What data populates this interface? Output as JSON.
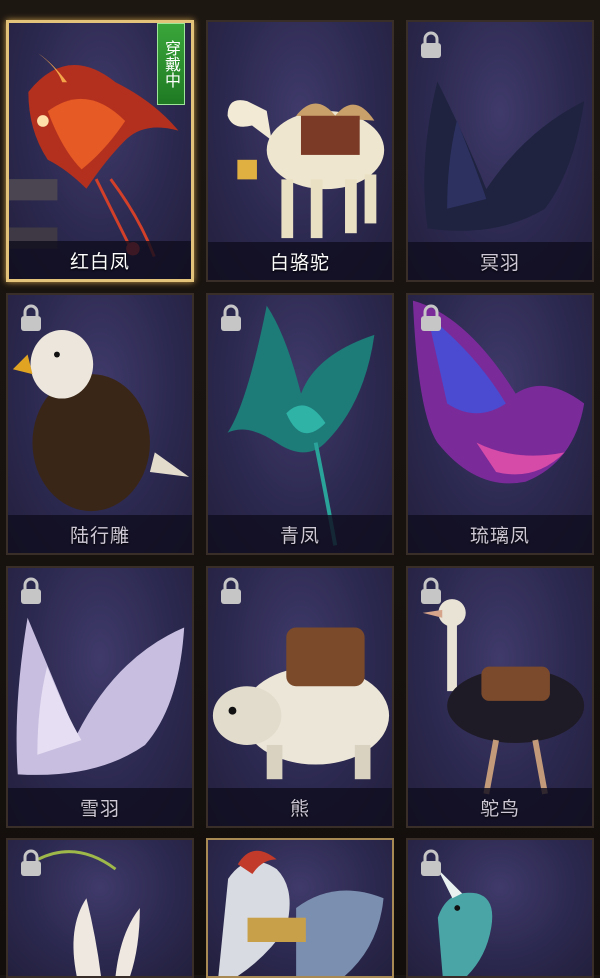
{
  "badge_text": "穿戴中",
  "mounts": [
    {
      "name": "红白凤",
      "locked": false,
      "icon": "phoenix-red"
    },
    {
      "name": "白骆驼",
      "locked": false,
      "icon": "camel-white"
    },
    {
      "name": "冥羽",
      "locked": true,
      "icon": "wing-dark"
    },
    {
      "name": "陆行雕",
      "locked": true,
      "icon": "eagle"
    },
    {
      "name": "青凤",
      "locked": true,
      "icon": "phoenix-teal"
    },
    {
      "name": "琉璃凤",
      "locked": true,
      "icon": "phoenix-purple"
    },
    {
      "name": "雪羽",
      "locked": true,
      "icon": "wing-white"
    },
    {
      "name": "熊",
      "locked": true,
      "icon": "bear"
    },
    {
      "name": "鸵鸟",
      "locked": true,
      "icon": "ostrich"
    },
    {
      "name": "",
      "locked": true,
      "icon": "rabbit"
    },
    {
      "name": "",
      "locked": false,
      "icon": "horse"
    },
    {
      "name": "",
      "locked": true,
      "icon": "dragon"
    }
  ],
  "colors": {
    "accent_gold": "#e3c27a",
    "badge_green": "#2e8f2f",
    "card_bg": "#2c2950"
  }
}
